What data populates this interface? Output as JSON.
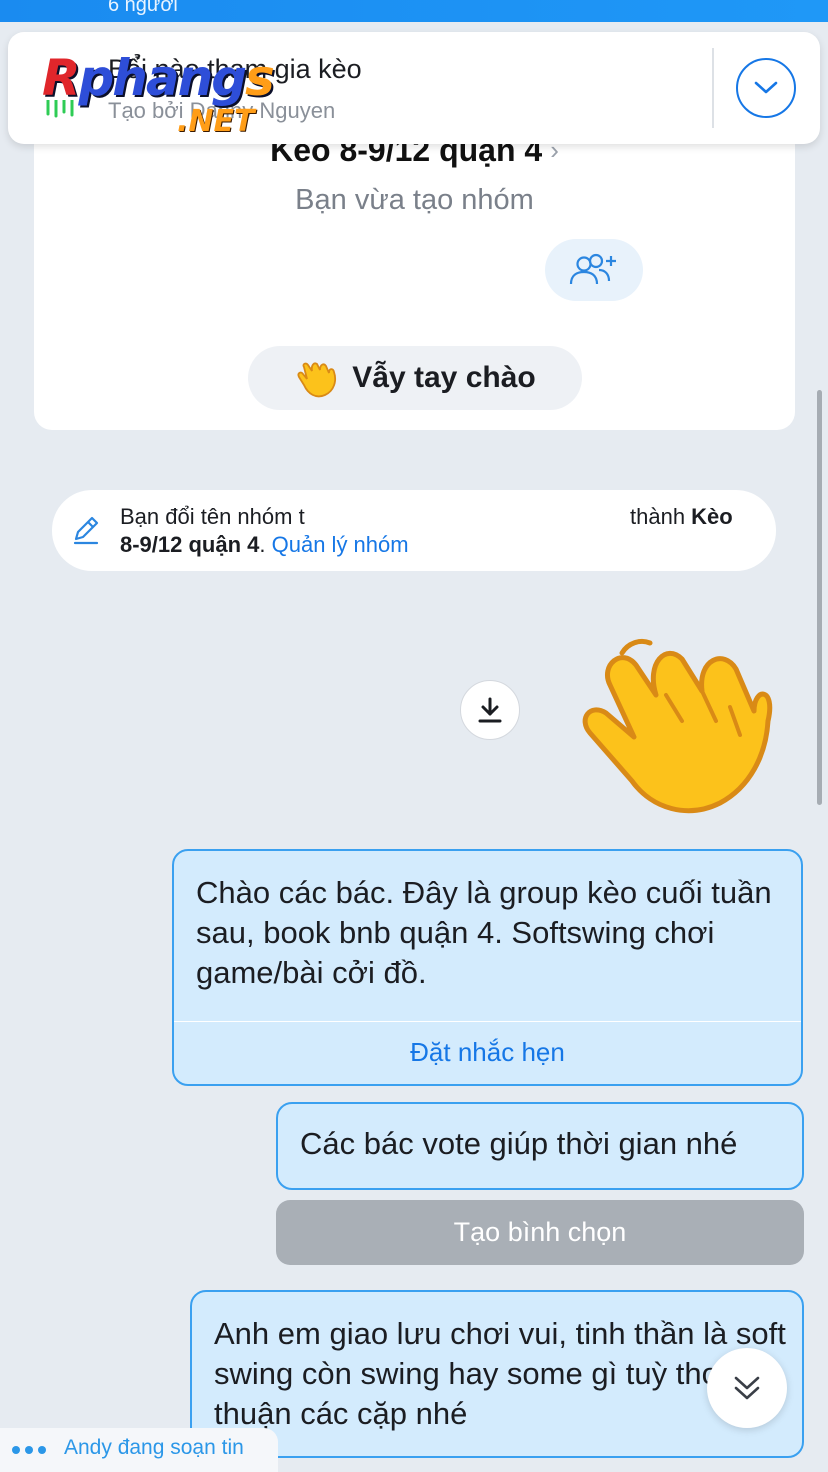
{
  "header": {
    "member_count": "6 người"
  },
  "pinned_banner": {
    "title": "Bổ̉i nào tham gia kèo",
    "subtitle": "Tạo bởi Danny Nguyen",
    "logo_main_r": "R",
    "logo_main_rest": "phang",
    "logo_main_s": "s",
    "logo_sub": ".NET"
  },
  "group_card": {
    "name": "Kèo 8-9/12 quận 4",
    "subtitle": "Bạn vừa tạo nhóm",
    "wave_label": "Vẫy tay chào"
  },
  "system_message": {
    "prefix": "Bạn đổi tên nhóm t",
    "suffix": "thành ",
    "new_name_part1": "Kèo",
    "new_name_part2": "8-9/12 quận 4",
    "period": ". ",
    "manage_link": "Quản lý nhóm"
  },
  "messages": [
    {
      "text": "Chào các bác. Đây là group kèo cuối tuần sau, book bnb quận 4. Softswing chơi game/bài cởi đồ.",
      "action": "Đặt nhắc hẹn"
    },
    {
      "text": "Các bác vote giúp thời gian nhé",
      "action": "Tạo bình chọn"
    },
    {
      "text": "Anh em giao lưu chơi vui, tinh thần là soft swing còn swing hay some gì tuỳ thoả thuận các cặp nhé"
    }
  ],
  "typing_indicator": "Andy đang soạn tin",
  "colors": {
    "accent": "#1677e6",
    "bubble_bg": "#d3ebfd",
    "bubble_border": "#3aa0f0",
    "chat_bg": "#e6ebf1"
  }
}
